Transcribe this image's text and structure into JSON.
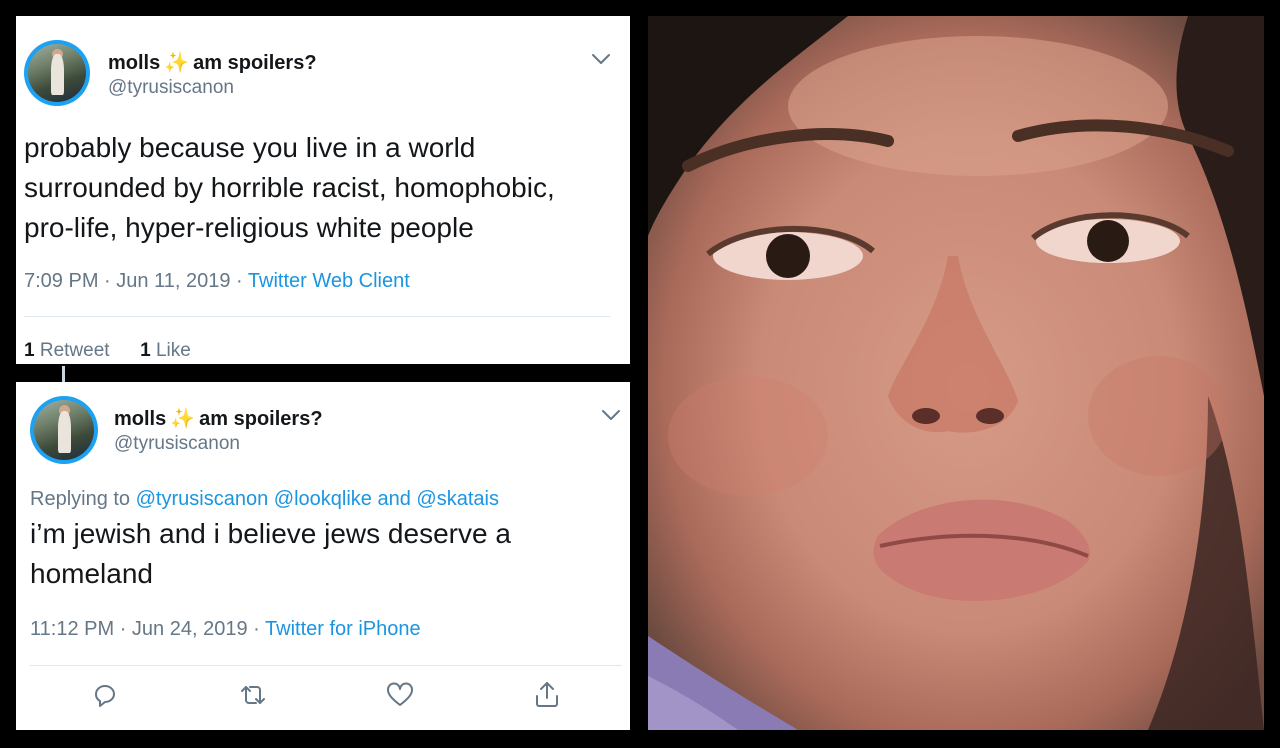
{
  "tweets": [
    {
      "display_name": "molls",
      "name_emoji": "✨",
      "name_suffix": "am spoilers?",
      "handle": "@tyrusiscanon",
      "text_lines": [
        "probably because you live in a world",
        "surrounded by horrible racist, homophobic,",
        "pro-life, hyper-religious white people"
      ],
      "time": "7:09 PM",
      "separator": "·",
      "date": "Jun 11, 2019",
      "source": "Twitter Web Client",
      "retweets_count": "1",
      "retweets_label": "Retweet",
      "likes_count": "1",
      "likes_label": "Like"
    },
    {
      "display_name": "molls",
      "name_emoji": "✨",
      "name_suffix": "am spoilers?",
      "handle": "@tyrusiscanon",
      "reply_prefix": "Replying to",
      "reply_mention_1": "@tyrusiscanon",
      "reply_mention_2": "@lookqlike",
      "reply_and": "and",
      "reply_mention_3": "@skatais",
      "text_lines": [
        "i’m jewish and i believe jews deserve a",
        "homeland"
      ],
      "time": "11:12 PM",
      "separator": "·",
      "date": "Jun 24, 2019",
      "source": "Twitter for iPhone"
    }
  ],
  "icons": {
    "menu": "chevron-down-icon",
    "reply": "reply-icon",
    "retweet": "retweet-icon",
    "like": "heart-icon",
    "share": "share-icon"
  },
  "colors": {
    "link_blue": "#1b95e0",
    "avatar_ring": "#1da1f2",
    "text_primary": "#14171a",
    "text_secondary": "#657786",
    "background": "#000000"
  }
}
